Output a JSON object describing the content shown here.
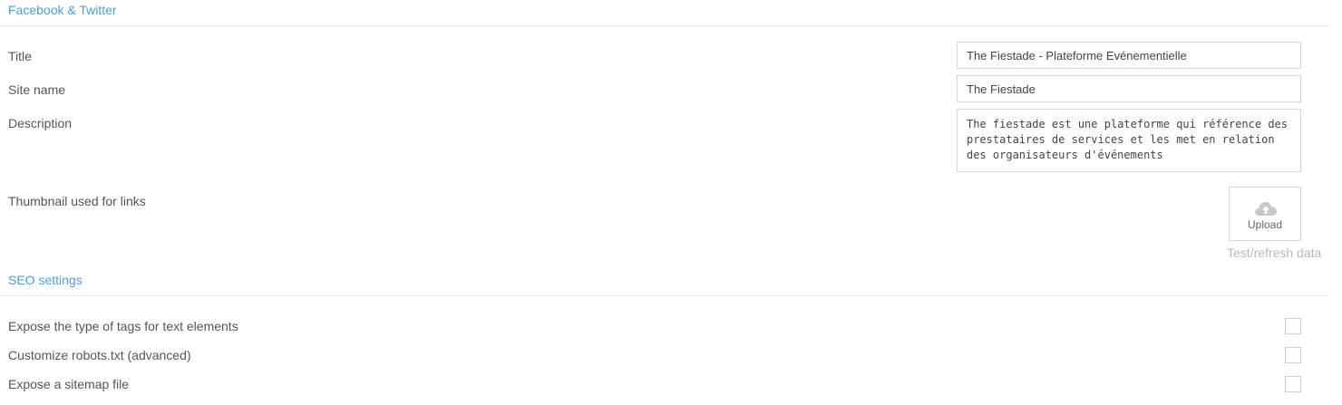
{
  "facebook_twitter": {
    "heading": "Facebook & Twitter",
    "title_label": "Title",
    "title_value": "The Fiestade - Plateforme Evénementielle",
    "site_name_label": "Site name",
    "site_name_value": "The Fiestade",
    "description_label": "Description",
    "description_value": "The fiestade est une plateforme qui référence des prestataires de services et les met en relation des organisateurs d'événements",
    "thumbnail_label": "Thumbnail used for links",
    "upload_label": "Upload",
    "upload_icon": "cloud-upload-icon",
    "test_refresh_label": "Test/refresh data"
  },
  "seo_settings": {
    "heading": "SEO settings",
    "options": [
      {
        "label": "Expose the type of tags for text elements",
        "checked": false
      },
      {
        "label": "Customize robots.txt (advanced)",
        "checked": false
      },
      {
        "label": "Expose a sitemap file",
        "checked": false
      }
    ]
  },
  "colors": {
    "section_heading": "#4a9fd8",
    "label_text": "#555555",
    "muted_text": "#b8b8b8",
    "border": "#d6d6d6"
  }
}
